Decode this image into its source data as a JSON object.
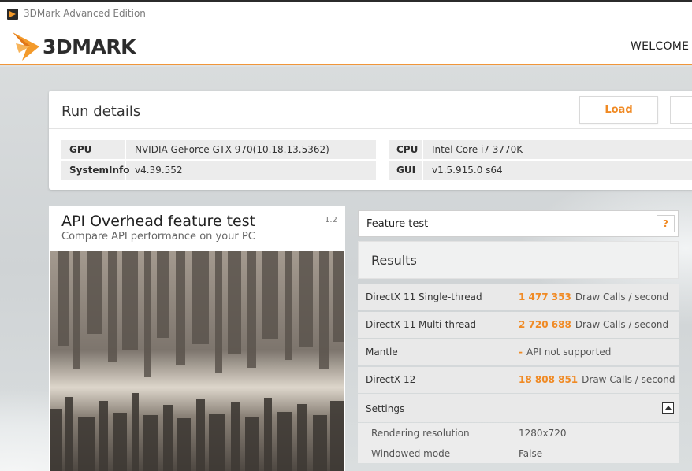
{
  "window": {
    "title": "3DMark Advanced Edition"
  },
  "header": {
    "logo_text": "3DMARK",
    "nav_label": "WELCOME",
    "accent_color": "#f08a24"
  },
  "run_details": {
    "heading": "Run details",
    "load_label": "Load",
    "rows": [
      {
        "key": "GPU",
        "value": "NVIDIA GeForce GTX 970(10.18.13.5362)"
      },
      {
        "key": "SystemInfo",
        "value": "v4.39.552"
      },
      {
        "key": "CPU",
        "value": "Intel Core i7 3770K"
      },
      {
        "key": "GUI",
        "value": "v1.5.915.0 s64"
      }
    ]
  },
  "test": {
    "title": "API Overhead feature test",
    "subtitle": "Compare API performance on your PC",
    "version": "1.2"
  },
  "feature": {
    "label": "Feature test",
    "help_label": "?"
  },
  "results": {
    "heading": "Results",
    "rows": [
      {
        "name": "DirectX 11 Single-thread",
        "value": "1 477 353",
        "unit": "Draw Calls / second"
      },
      {
        "name": "DirectX 11 Multi-thread",
        "value": "2 720 688",
        "unit": "Draw Calls / second"
      },
      {
        "name": "Mantle",
        "value": "-",
        "unit": "API not supported"
      },
      {
        "name": "DirectX 12",
        "value": "18 808 851",
        "unit": "Draw Calls / second"
      }
    ]
  },
  "settings": {
    "heading": "Settings",
    "rows": [
      {
        "name": "Rendering resolution",
        "value": "1280x720"
      },
      {
        "name": "Windowed mode",
        "value": "False"
      }
    ]
  }
}
